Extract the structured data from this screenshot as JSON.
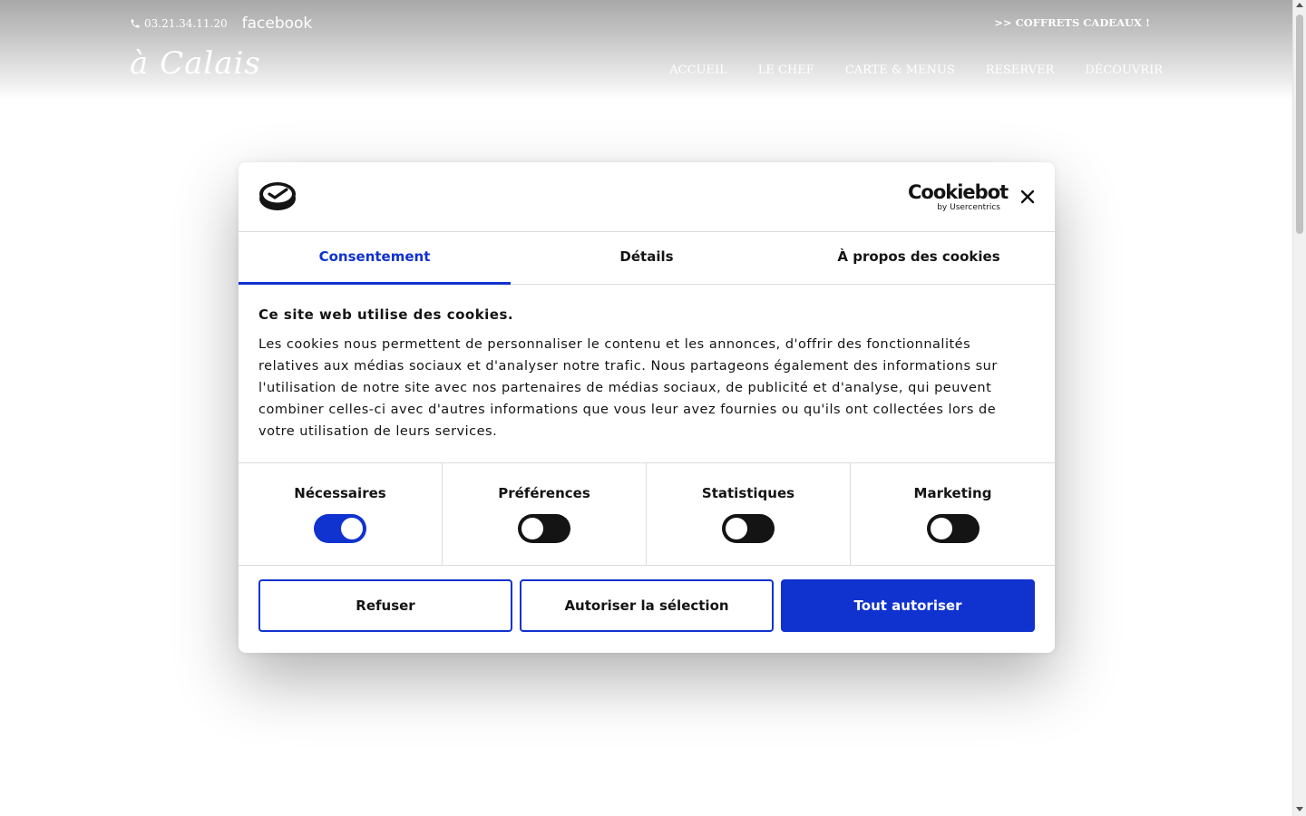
{
  "header": {
    "phone": "03.21.34.11.20",
    "facebook": "facebook",
    "gift_link": ">> COFFRETS CADEAUX !",
    "logo": "à Calais",
    "nav": [
      "ACCUEIL",
      "LE CHEF",
      "CARTE & MENUS",
      "RESERVER",
      "DÉCOUVRIR"
    ]
  },
  "dialog": {
    "brand": {
      "name": "Cookiebot",
      "by": "by Usercentrics"
    },
    "tabs": [
      {
        "label": "Consentement",
        "active": true
      },
      {
        "label": "Détails",
        "active": false
      },
      {
        "label": "À propos des cookies",
        "active": false
      }
    ],
    "title": "Ce site web utilise des cookies.",
    "text": "Les cookies nous permettent de personnaliser le contenu et les annonces, d'offrir des fonctionnalités relatives aux médias sociaux et d'analyser notre trafic. Nous partageons également des informations sur l'utilisation de notre site avec nos partenaires de médias sociaux, de publicité et d'analyse, qui peuvent combiner celles-ci avec d'autres informations que vous leur avez fournies ou qu'ils ont collectées lors de votre utilisation de leurs services.",
    "toggles": [
      {
        "label": "Nécessaires",
        "on": true
      },
      {
        "label": "Préférences",
        "on": false
      },
      {
        "label": "Statistiques",
        "on": false
      },
      {
        "label": "Marketing",
        "on": false
      }
    ],
    "buttons": {
      "refuse": "Refuser",
      "allow_selection": "Autoriser la sélection",
      "allow_all": "Tout autoriser"
    }
  },
  "colors": {
    "accent": "#1032cf",
    "text": "#141414",
    "border": "#dcdcdc"
  },
  "icons": {
    "phone": "phone-icon",
    "close": "close-icon",
    "logo": "cookie-logo-icon"
  }
}
